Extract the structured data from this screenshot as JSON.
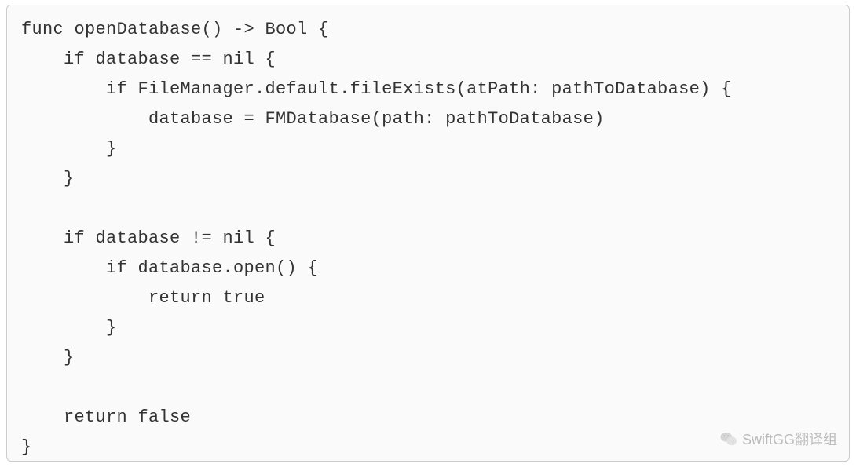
{
  "code": {
    "lines": [
      "func openDatabase() -> Bool {",
      "    if database == nil {",
      "        if FileManager.default.fileExists(atPath: pathToDatabase) {",
      "            database = FMDatabase(path: pathToDatabase)",
      "        }",
      "    }",
      "",
      "    if database != nil {",
      "        if database.open() {",
      "            return true",
      "        }",
      "    }",
      "",
      "    return false",
      "}"
    ]
  },
  "watermark": {
    "text": "SwiftGG翻译组"
  }
}
